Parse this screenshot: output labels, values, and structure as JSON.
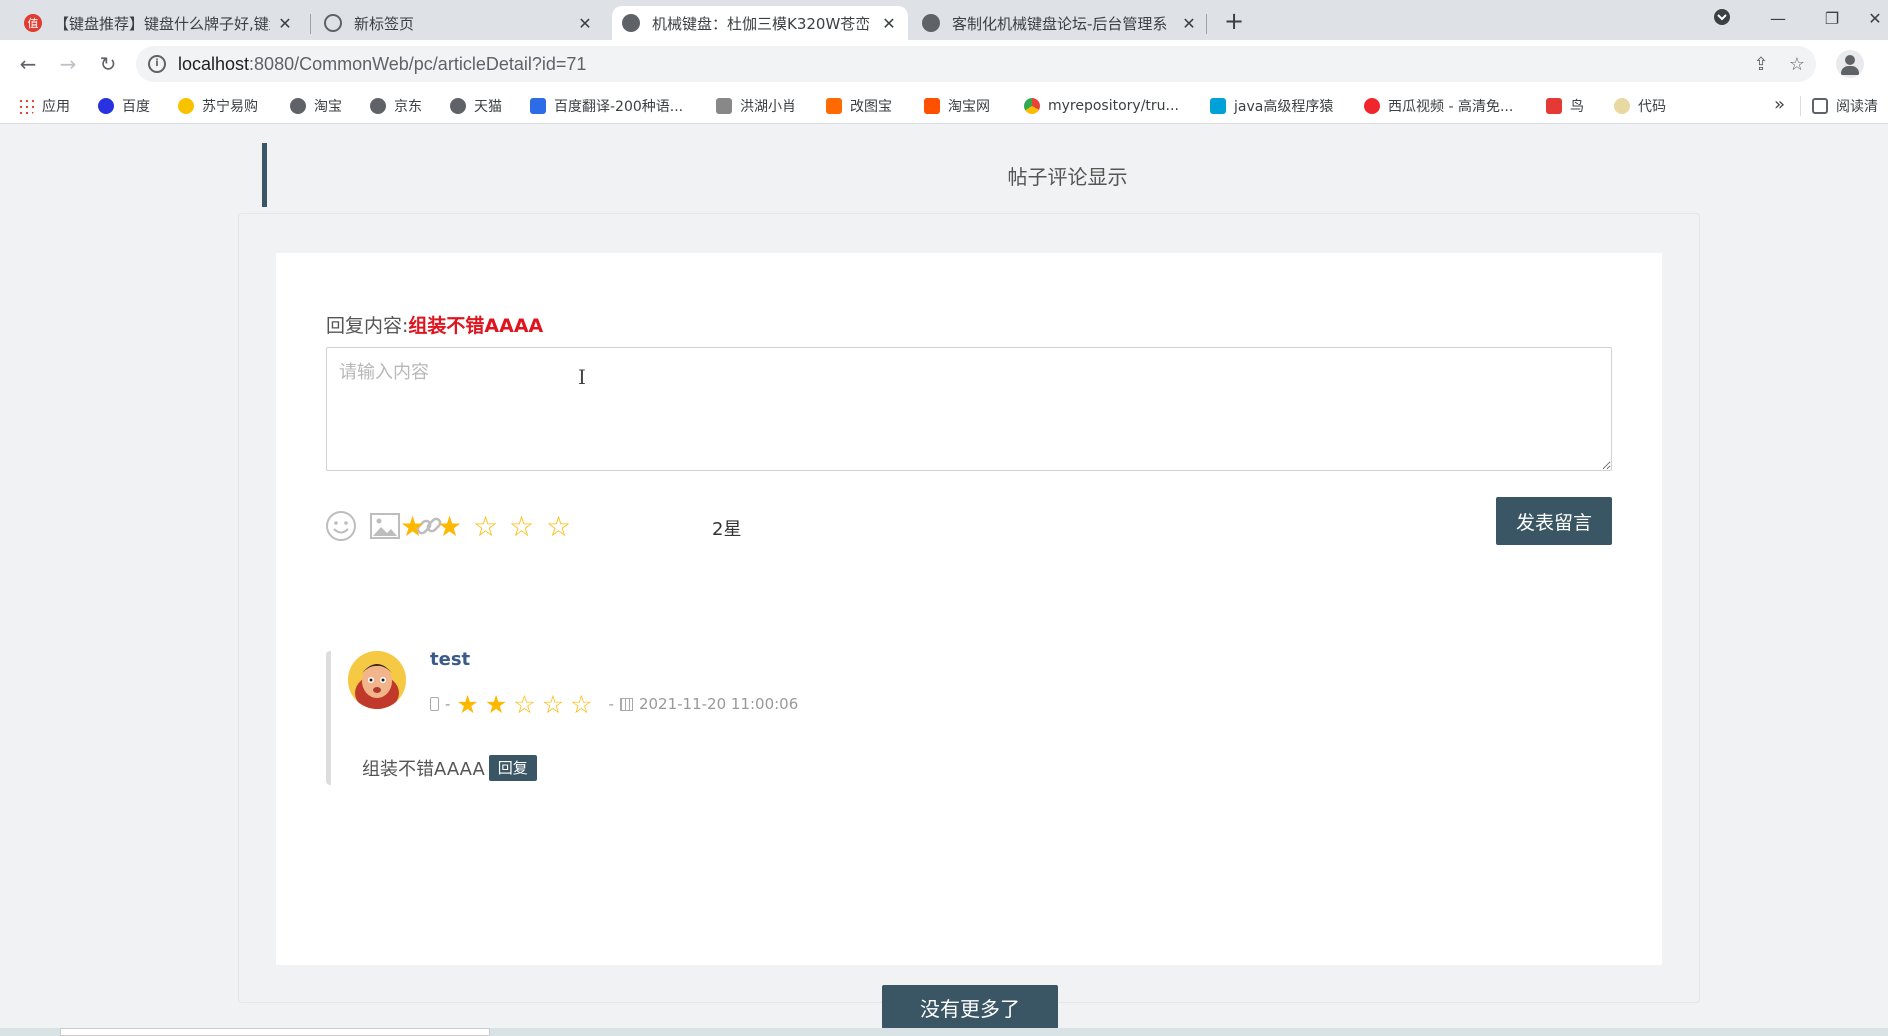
{
  "browser": {
    "tabs": [
      {
        "title": "【键盘推荐】键盘什么牌子好,键盘",
        "favicon_letter": "值",
        "favicon_color": "#e03c31",
        "active": false
      },
      {
        "title": "新标签页",
        "favicon_letter": "",
        "favicon_color": "#5f6368",
        "active": false
      },
      {
        "title": "机械键盘：杜伽三模K320W苍峦",
        "favicon_letter": "",
        "favicon_color": "#5f6368",
        "active": true
      },
      {
        "title": "客制化机械键盘论坛-后台管理系",
        "favicon_letter": "",
        "favicon_color": "#5f6368",
        "active": false
      }
    ],
    "url_host": "localhost",
    "url_rest": ":8080/CommonWeb/pc/articleDetail?id=71",
    "bookmarks": [
      {
        "label": "应用",
        "color": "#4285f4"
      },
      {
        "label": "百度",
        "color": "#2932e1"
      },
      {
        "label": "苏宁易购",
        "color": "#f9c200"
      },
      {
        "label": "淘宝",
        "color": "#5f6368"
      },
      {
        "label": "京东",
        "color": "#5f6368"
      },
      {
        "label": "天猫",
        "color": "#5f6368"
      },
      {
        "label": "百度翻译-200种语...",
        "color": "#2e6be6"
      },
      {
        "label": "洪湖小肖",
        "color": "#888888"
      },
      {
        "label": "改图宝",
        "color": "#ff6a00"
      },
      {
        "label": "淘宝网",
        "color": "#ff5000"
      },
      {
        "label": "myrepository/tru...",
        "color": "#1aa260"
      },
      {
        "label": "java高级程序猿",
        "color": "#00a1d6"
      },
      {
        "label": "西瓜视频 - 高清免...",
        "color": "#f0262c"
      },
      {
        "label": "鸟",
        "color": "#e53935"
      },
      {
        "label": "代码",
        "color": "#e8d9a0"
      },
      {
        "label": "阅读清",
        "color": "#5f6368"
      }
    ]
  },
  "page": {
    "section_title": "帖子评论显示",
    "reply_prefix": "回复内容:",
    "reply_target": "组装不错AAAA",
    "textarea_placeholder": "请输入内容",
    "rating_stars": 2,
    "rating_max": 5,
    "rating_text": "2星",
    "submit_label": "发表留言",
    "comment": {
      "user": "test",
      "rating_stars": 2,
      "time": "2021-11-20 11:00:06",
      "text": "组装不错AAAA",
      "reply_label": "回复"
    },
    "more_label": "没有更多了"
  },
  "colors": {
    "accent": "#3a5665",
    "star": "#ffb800",
    "highlight": "#e0141e"
  }
}
